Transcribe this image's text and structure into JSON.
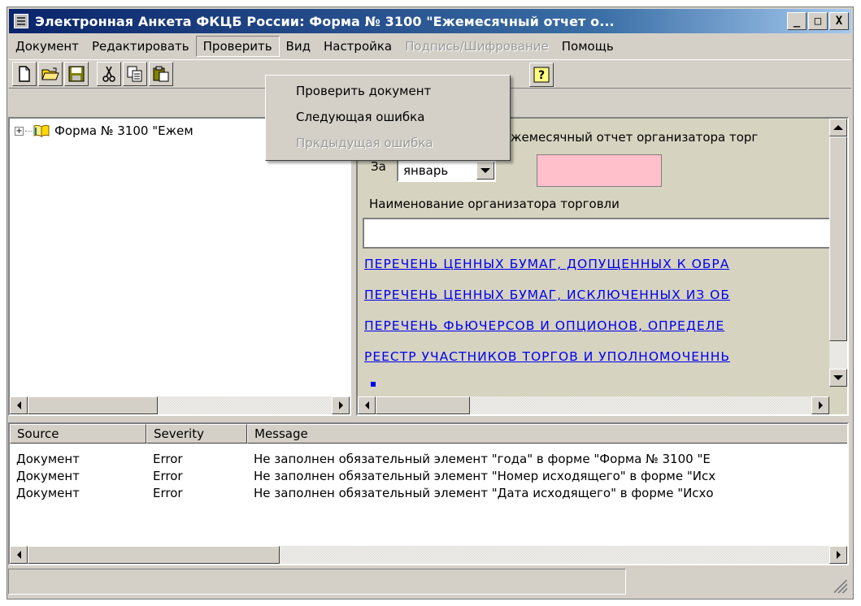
{
  "window": {
    "title": "Электронная Анкета ФКЦБ России: Форма № 3100 \"Ежемесячный отчет о...",
    "minimize_glyph": "_",
    "maximize_glyph": "□",
    "close_glyph": "X"
  },
  "menu": {
    "items": [
      {
        "label": "Документ"
      },
      {
        "label": "Редактировать"
      },
      {
        "label": "Проверить"
      },
      {
        "label": "Вид"
      },
      {
        "label": "Настройка"
      },
      {
        "label": "Подпись/Шифрование"
      },
      {
        "label": "Помощь"
      }
    ]
  },
  "dropdown": {
    "items": [
      {
        "label": "Проверить документ"
      },
      {
        "label": "Следующая ошибка"
      },
      {
        "label": "Пркдыдущая ошибка"
      }
    ]
  },
  "toolbar": {
    "icons": [
      "new-file-icon",
      "open-folder-icon",
      "save-icon",
      "cut-icon",
      "copy-icon",
      "paste-icon",
      "help-icon"
    ],
    "help_glyph": "?"
  },
  "tree": {
    "expand_glyph": "+",
    "root_label": "Форма № 3100 \"Ежем"
  },
  "form": {
    "heading": "жемесячный отчет организатора торг",
    "za_label": "За",
    "month_value": "январь",
    "org_label": "Наименование организатора торговли",
    "org_value": "",
    "links": [
      "ПЕРЕЧЕНЬ ЦЕННЫХ БУМАГ, ДОПУЩЕННЫХ К ОБРА",
      "ПЕРЕЧЕНЬ ЦЕННЫХ БУМАГ, ИСКЛЮЧЕННЫХ ИЗ ОБ",
      "ПЕРЕЧЕНЬ ФЬЮЧЕРСОВ И ОПЦИОНОВ, ОПРЕДЕЛЕ",
      "РЕЕСТР УЧАСТНИКОВ ТОРГОВ И УПОЛНОМОЧЕННЬ"
    ],
    "required_color": "#ffc0cb"
  },
  "messages": {
    "columns": [
      "Source",
      "Severity",
      "Message"
    ],
    "rows": [
      {
        "source": "Документ",
        "severity": "Error",
        "message": "Не заполнен обязательный элемент \"года\" в форме \"Форма № 3100 \"Е"
      },
      {
        "source": "Документ",
        "severity": "Error",
        "message": "Не заполнен обязательный элемент \"Номер исходящего\" в форме \"Исх"
      },
      {
        "source": "Документ",
        "severity": "Error",
        "message": "Не заполнен обязательный элемент \"Дата исходящего\" в форме \"Исхо"
      }
    ]
  },
  "status": {
    "text": ""
  }
}
